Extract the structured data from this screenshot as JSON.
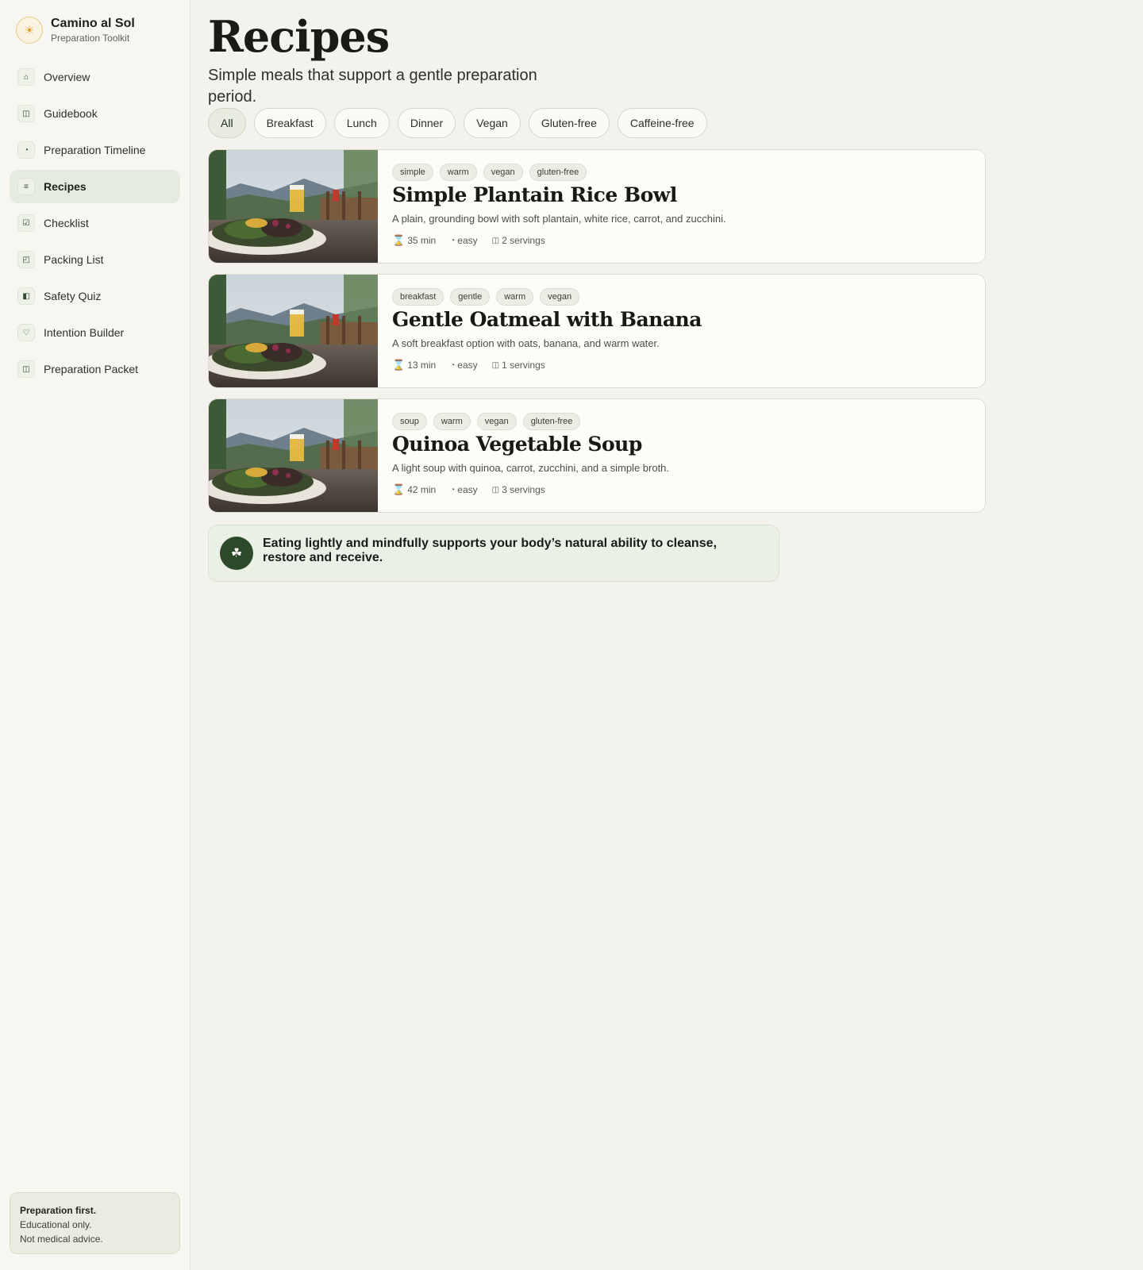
{
  "brand": {
    "name": "Camino al Sol",
    "subtitle": "Preparation Toolkit",
    "icon": "sun-icon"
  },
  "sidebar": {
    "items": [
      {
        "label": "Overview",
        "icon": "home-icon",
        "glyph": "⌂",
        "active": false
      },
      {
        "label": "Guidebook",
        "icon": "book-icon",
        "glyph": "◫",
        "active": false
      },
      {
        "label": "Preparation Timeline",
        "icon": "clock-icon",
        "glyph": "◔",
        "active": false
      },
      {
        "label": "Recipes",
        "icon": "list-icon",
        "glyph": "≡",
        "active": true
      },
      {
        "label": "Checklist",
        "icon": "checkbox-icon",
        "glyph": "☑",
        "active": false
      },
      {
        "label": "Packing List",
        "icon": "bag-icon",
        "glyph": "◰",
        "active": false
      },
      {
        "label": "Safety Quiz",
        "icon": "shield-icon",
        "glyph": "◧",
        "active": false
      },
      {
        "label": "Intention Builder",
        "icon": "heart-icon",
        "glyph": "♡",
        "active": false
      },
      {
        "label": "Preparation Packet",
        "icon": "packet-icon",
        "glyph": "◫",
        "active": false
      }
    ],
    "disclaimer": {
      "line1": "Preparation first.",
      "line2": "Educational only.",
      "line3": "Not medical advice."
    }
  },
  "page": {
    "title": "Recipes",
    "subtitle": "Simple meals that support a gentle preparation period."
  },
  "filters": [
    {
      "label": "All",
      "active": true
    },
    {
      "label": "Breakfast",
      "active": false
    },
    {
      "label": "Lunch",
      "active": false
    },
    {
      "label": "Dinner",
      "active": false
    },
    {
      "label": "Vegan",
      "active": false
    },
    {
      "label": "Gluten-free",
      "active": false
    },
    {
      "label": "Caffeine-free",
      "active": false
    }
  ],
  "recipes": [
    {
      "tags": [
        "simple",
        "warm",
        "vegan",
        "gluten-free"
      ],
      "title": "Simple Plantain Rice Bowl",
      "description": "A plain, grounding bowl with soft plantain, white rice, carrot, and zucchini.",
      "time": "35 min",
      "difficulty": "easy",
      "servings": "2 servings"
    },
    {
      "tags": [
        "breakfast",
        "gentle",
        "warm",
        "vegan"
      ],
      "title": "Gentle Oatmeal with Banana",
      "description": "A soft breakfast option with oats, banana, and warm water.",
      "time": "13 min",
      "difficulty": "easy",
      "servings": "1 servings"
    },
    {
      "tags": [
        "soup",
        "warm",
        "vegan",
        "gluten-free"
      ],
      "title": "Quinoa Vegetable Soup",
      "description": "A light soup with quinoa, carrot, zucchini, and a simple broth.",
      "time": "42 min",
      "difficulty": "easy",
      "servings": "3 servings"
    }
  ],
  "meta_icons": {
    "time": "hourglass-icon",
    "difficulty": "gauge-icon",
    "servings": "bowl-icon"
  },
  "note": {
    "icon": "clover-icon",
    "text": "Eating lightly and mindfully supports your body’s natural ability to cleanse, restore and receive."
  },
  "colors": {
    "accent": "#2c4a2a",
    "active_bg": "#e5ebdf",
    "page_bg": "#f4f2ec",
    "brand_gold": "#d99a2b"
  }
}
